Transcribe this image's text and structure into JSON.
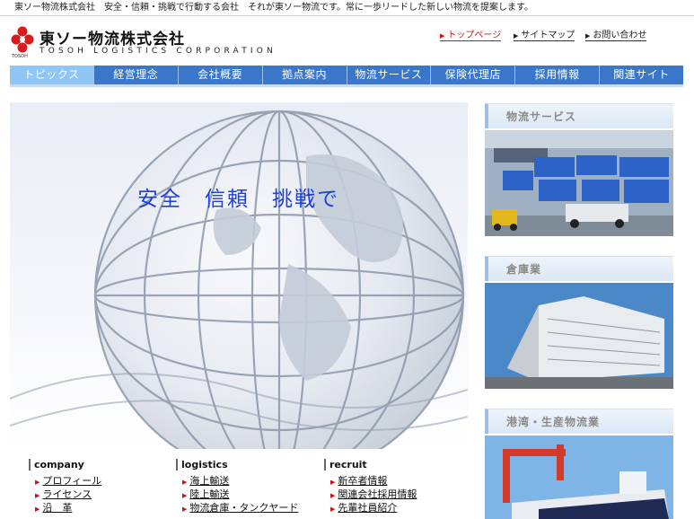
{
  "tagline": "東ソー物流株式会社　安全・信頼・挑戦で行動する会社　それが東ソー物流です。常に一歩リードした新しい物流を提案します。",
  "logo": {
    "name_jp": "東ソー物流株式会社",
    "name_en": "TOSOH LOGISTICS CORPORATION",
    "mark_label": "TOSOH"
  },
  "utility_links": [
    {
      "label": "トップページ",
      "active": true
    },
    {
      "label": "サイトマップ",
      "active": false
    },
    {
      "label": "お問い合わせ",
      "active": false
    }
  ],
  "nav": [
    {
      "label": "トピックス",
      "active": true
    },
    {
      "label": "経営理念",
      "active": false
    },
    {
      "label": "会社概要",
      "active": false
    },
    {
      "label": "拠点案内",
      "active": false
    },
    {
      "label": "物流サービス",
      "active": false
    },
    {
      "label": "保険代理店",
      "active": false
    },
    {
      "label": "採用情報",
      "active": false
    },
    {
      "label": "関連サイト",
      "active": false
    }
  ],
  "hero": {
    "catchphrase": "安全　信頼　挑戦で"
  },
  "columns": [
    {
      "heading": "company",
      "links": [
        "プロフィール",
        "ライセンス",
        "沿　革"
      ]
    },
    {
      "heading": "logistics",
      "links": [
        "海上輸送",
        "陸上輸送",
        "物流倉庫・タンクヤード"
      ]
    },
    {
      "heading": "recruit",
      "links": [
        "新卒者情報",
        "関連会社採用情報",
        "先輩社員紹介"
      ]
    }
  ],
  "sections": [
    {
      "title": "物流サービス"
    },
    {
      "title": "倉庫業"
    },
    {
      "title": "港湾・生産物流業"
    }
  ],
  "colors": {
    "nav_bg": "#3a76c9",
    "nav_active": "#8fc6f5",
    "accent_red": "#cc1111",
    "catch_blue": "#1c3fe0",
    "logo_red": "#d81c1c"
  }
}
